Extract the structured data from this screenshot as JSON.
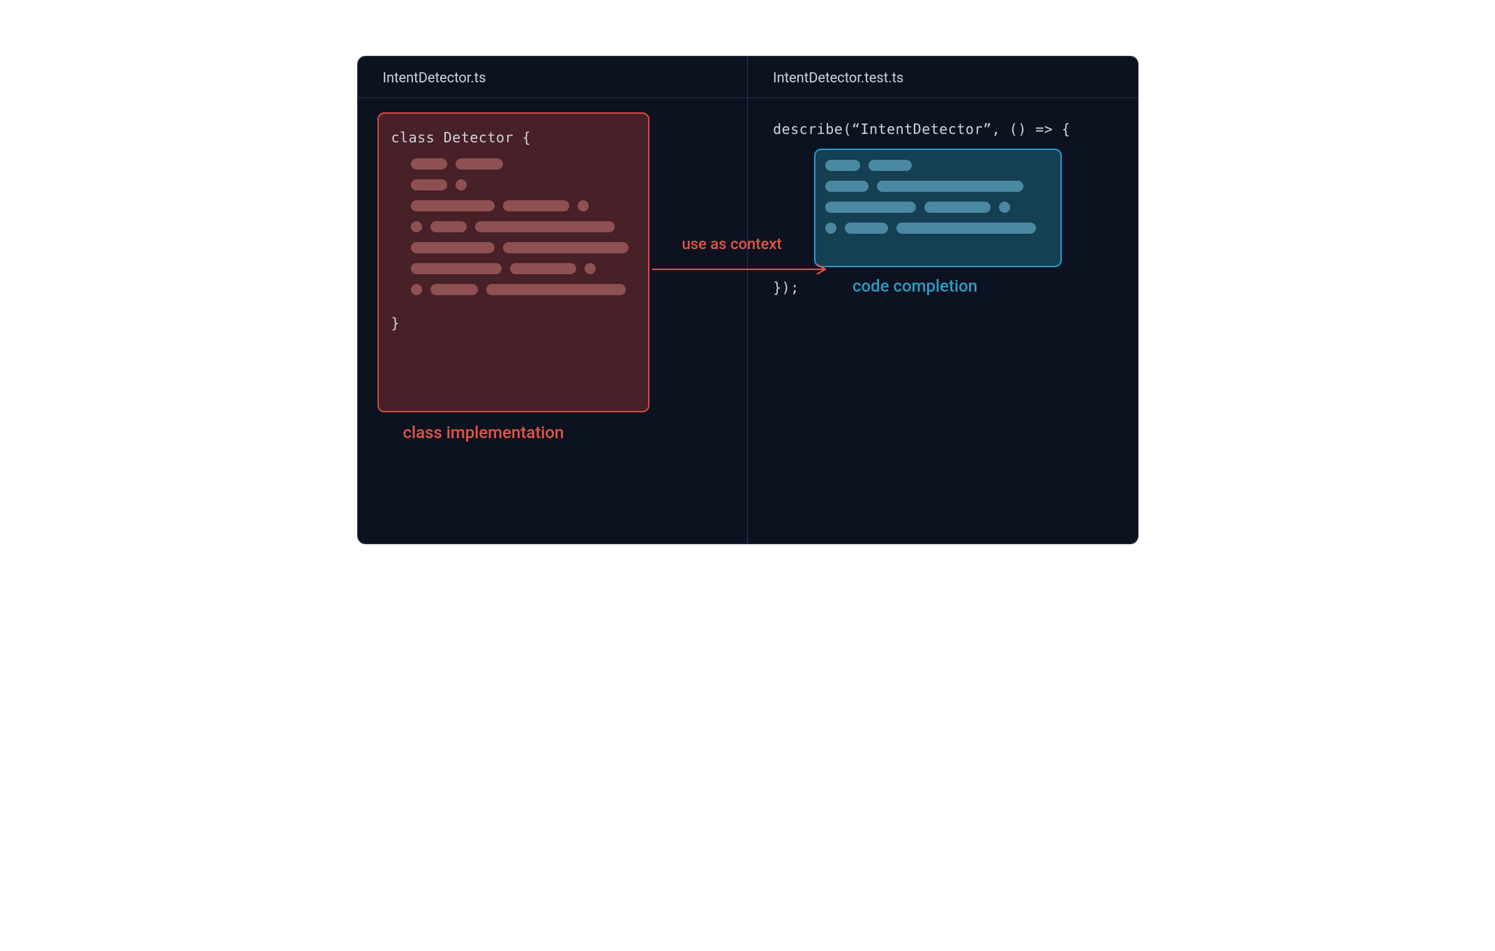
{
  "editor": {
    "leftPane": {
      "tabLabel": "IntentDetector.ts",
      "codeLine1": "class Detector {",
      "codeLine2": "}",
      "caption": "class implementation"
    },
    "rightPane": {
      "tabLabel": "IntentDetector.test.ts",
      "codeLine1": "describe(“IntentDetector”, () => {",
      "codeLine2": "});",
      "caption": "code completion"
    },
    "arrow": {
      "label": "use as context"
    }
  },
  "colors": {
    "background": "#0c1220",
    "border": "#2a3548",
    "textPrimary": "#d0d4dd",
    "red": "#e35445",
    "redBorder": "#d84a3f",
    "blue": "#2a9bc4"
  }
}
